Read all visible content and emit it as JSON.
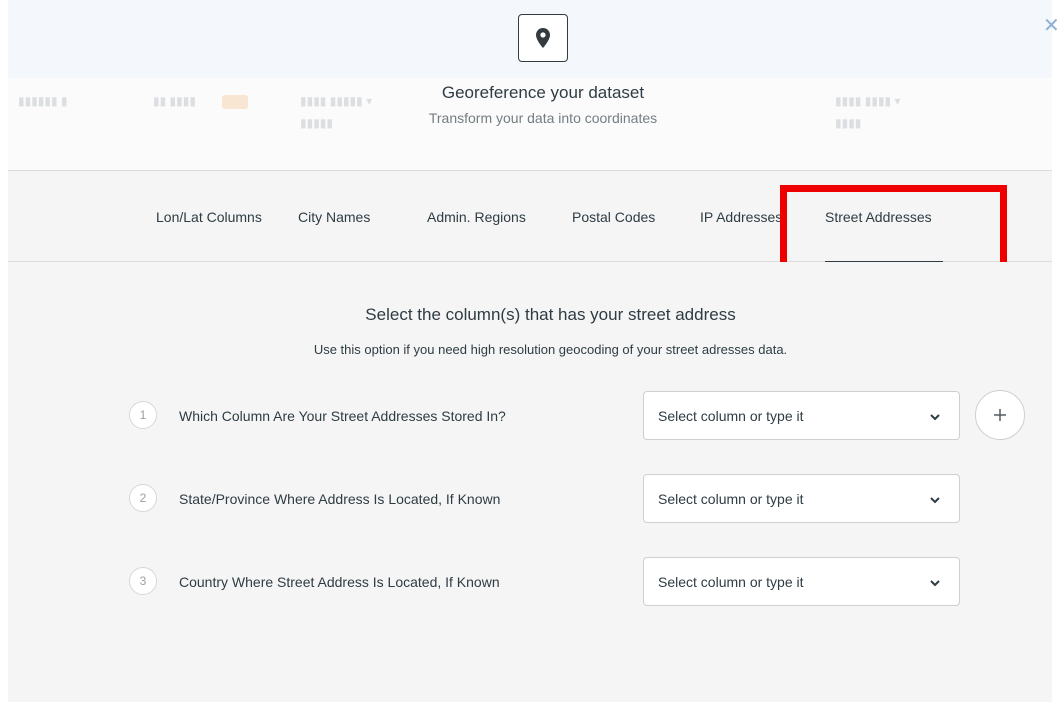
{
  "modal": {
    "icon": "map-pin-icon",
    "title": "Georeference your dataset",
    "subtitle": "Transform your data into coordinates"
  },
  "tabs": [
    {
      "label": "Lon/Lat Columns"
    },
    {
      "label": "City Names"
    },
    {
      "label": "Admin. Regions"
    },
    {
      "label": "Postal Codes"
    },
    {
      "label": "IP Addresses"
    },
    {
      "label": "Street Addresses",
      "active": true
    }
  ],
  "content": {
    "title": "Select the column(s) that has your street address",
    "description": "Use this option if you need high resolution geocoding of your street adresses data.",
    "steps": [
      {
        "number": "1",
        "label": "Which Column Are Your Street Addresses Stored In?",
        "placeholder": "Select column or type it"
      },
      {
        "number": "2",
        "label": "State/Province Where Address Is Located, If Known",
        "placeholder": "Select column or type it"
      },
      {
        "number": "3",
        "label": "Country Where Street Address Is Located, If Known",
        "placeholder": "Select column or type it"
      }
    ]
  },
  "colors": {
    "highlight": "#ee0000",
    "tabs_background": "#f5f5f5",
    "text": "#2e3c43"
  }
}
